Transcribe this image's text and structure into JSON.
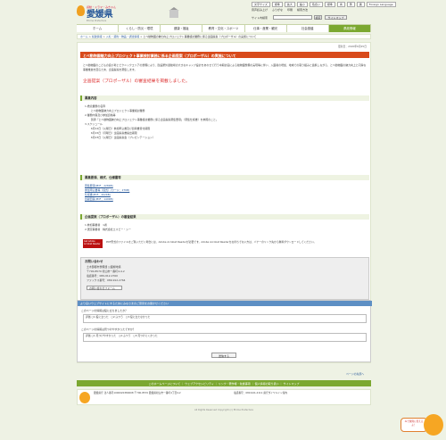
{
  "header": {
    "logo_tagline": "感動・ドラマ・みきゃん",
    "logo_name": "愛媛県",
    "logo_sub": "Ehime Prefecture",
    "util_row1": [
      "文字サイズ",
      "標準",
      "拡大",
      "縮小",
      "色合い",
      "標準",
      "青",
      "黄",
      "黒",
      "Foreign Language"
    ],
    "util_row2": [
      "音声読み上げ",
      "ふりがな",
      "印刷",
      "検索方法"
    ],
    "search_label": "サイト内検索",
    "search_button": "検索",
    "search_site_button": "サイトマップ"
  },
  "nav": [
    {
      "label": "ホーム",
      "active": false
    },
    {
      "label": "くらし・防災・環境",
      "active": false
    },
    {
      "label": "健康・福祉",
      "active": false
    },
    {
      "label": "教育・文化・スポーツ",
      "active": false
    },
    {
      "label": "仕事・産業・観光",
      "active": false
    },
    {
      "label": "社会基盤",
      "active": false
    },
    {
      "label": "県政情報",
      "active": true
    }
  ],
  "breadcrumb": [
    "ホーム",
    "県政情報",
    "入札・契約・物品・調達情報",
    "とべ動物園の魅力向上プロジェクト事業検討業務に係る企画提案（プロポーザル）の実施について"
  ],
  "main": {
    "updated": "更新日：2020年6月25日",
    "title": "とべ動物園魅力向上プロジェクト事業検討業務に係る企画提案（プロポーザル）の実施について",
    "intro": "とべ動物園のこどもの遊び場とピクニックエリアの整備により、既設屋外運動場の大きなキャンプ設計をあわせて行う中期計画による動物園整備の実現等に伴い、入園者の増加、地域での取り組みと連携しながら、とべ動物園の魅力向上と円滑な事業推進を図るため、企画提案を募集します。",
    "notice": "企画提案（プロポーザル）の審査結果を掲載しました。",
    "sec1_title": "募集内容",
    "sec1_lines": [
      "1.委託業務の名称",
      "　とべ動物園魅力向上プロジェクト事業検討業務",
      "2.業務内容及び参加資格等",
      "　別添「とべ動物園魅力向上プロジェクト事業検討業務に係る企画提案募集要項」（募集仕様書）を参照のこと。",
      "3.スケジュール",
      "　6月12日（火曜日）参加申込書及び質問書受付期限",
      "　6月15日（月曜日）企画提案書提出期限",
      "　6月23日（火曜日）企画提案会（プレゼンテーション）"
    ],
    "sec2_title": "募集要領、様式、仕様書等",
    "sec2_links": [
      "募集要項(PDF：228KB)",
      "参加申込書等（様式）(ワード：27KB)",
      "仕様書(PDF：202KB)",
      "質疑回答(PDF：149KB)"
    ],
    "sec3_title": "企画提案（プロポーザル）の審査結果",
    "sec3_lines": [
      "1.参加事業者　1者",
      "2.選定事業者　株式会社エスピー・シー"
    ],
    "pdf_icon_label": "Get Adobe Acrobat Reader",
    "pdf_text": "PDF形式のファイルをご覧いただく場合には、Adobe Acrobat Readerが必要です。Adobe Acrobat Readerをお持ちでない方は、バナーのリンク先から無料ダウンロードしてください。",
    "inq_title": "お問い合わせ",
    "inq_lines": [
      "土木部都市整備課 公園緑地係",
      "〒790-8570 松山市一番町4-4-2",
      "電話番号：089-912-2760",
      "ファックス番号：089-912-2764"
    ],
    "inq_button": "お問い合わせフォーム"
  },
  "survey": {
    "header": "より良いウェブサイトにするためにみなさまのご意見をお聞かせください",
    "q1": "このページの情報は役に立ちましたか？",
    "q1_opts": "評価 ○1:役に立った　○2:ふつう　○3:役に立たなかった",
    "q2": "このページの情報は見つけやすかったですか？",
    "q2_opts": "評価 ○1:見つけやすかった　○2:ふつう　○3:見つけにくかった",
    "send": "送信する"
  },
  "footer": {
    "page_top": "ページの先頭へ",
    "links": "このホームページについて ｜ ウェブアクセシビリティ ｜ リンク・著作権・免責事項 ｜ 個人情報の取り扱い ｜ サイトマップ",
    "info_left": "愛媛県庁 法人番号1000020380008 〒790-8570 愛媛県松山市一番町4丁目4-2",
    "info_right": "電話番号：089-941-2111 県庁ダイヤルイン案内",
    "copyright": "All Rights Reserved Copyright (c) Ehime Prefecture",
    "chat_text": "AIで質問に答えるよ！"
  },
  "colors": {
    "accent": "#7ba830",
    "title": "#d84a1b",
    "link": "#2a5a9a",
    "survey": "#5d8fc4"
  }
}
